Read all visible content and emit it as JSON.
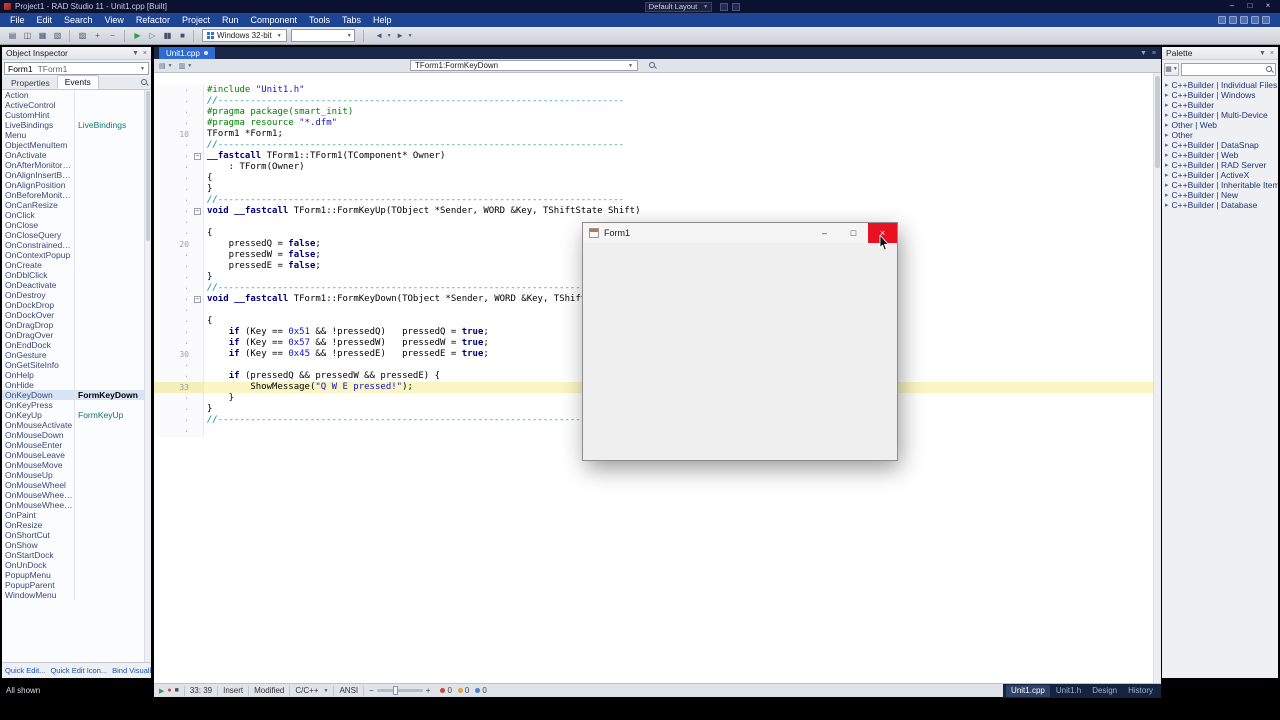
{
  "window": {
    "title": "Project1 - RAD Studio 11 - Unit1.cpp [Built]",
    "layout_combo": "Default Layout"
  },
  "menu": {
    "items": [
      "File",
      "Edit",
      "Search",
      "View",
      "Refactor",
      "Project",
      "Run",
      "Component",
      "Tools",
      "Tabs",
      "Help"
    ]
  },
  "toolbar": {
    "groups": [
      {
        "icons": [
          "new-file",
          "open-file",
          "save",
          "save-all"
        ]
      },
      {
        "icons": [
          "open-project",
          "add-to-project",
          "remove-from-project"
        ]
      },
      {
        "icons": [
          "run",
          "run-without-debugging",
          "pause",
          "stop"
        ]
      }
    ],
    "target_platform": "Windows 32-bit"
  },
  "object_inspector": {
    "title": "Object Inspector",
    "combo": {
      "instance": "Form1",
      "type": "TForm1"
    },
    "tabs": [
      "Properties",
      "Events"
    ],
    "rows": [
      {
        "name": "Action",
        "value": ""
      },
      {
        "name": "ActiveControl",
        "value": ""
      },
      {
        "name": "CustomHint",
        "value": ""
      },
      {
        "name": "LiveBindings",
        "value": "LiveBindings"
      },
      {
        "name": "Menu",
        "value": ""
      },
      {
        "name": "ObjectMenuItem",
        "value": ""
      },
      {
        "name": "OnActivate",
        "value": ""
      },
      {
        "name": "OnAfterMonitorDpiChanged",
        "value": ""
      },
      {
        "name": "OnAlignInsertBefore",
        "value": ""
      },
      {
        "name": "OnAlignPosition",
        "value": ""
      },
      {
        "name": "OnBeforeMonitorDpiChanged",
        "value": ""
      },
      {
        "name": "OnCanResize",
        "value": ""
      },
      {
        "name": "OnClick",
        "value": ""
      },
      {
        "name": "OnClose",
        "value": ""
      },
      {
        "name": "OnCloseQuery",
        "value": ""
      },
      {
        "name": "OnConstrainedResize",
        "value": ""
      },
      {
        "name": "OnContextPopup",
        "value": ""
      },
      {
        "name": "OnCreate",
        "value": ""
      },
      {
        "name": "OnDblClick",
        "value": ""
      },
      {
        "name": "OnDeactivate",
        "value": ""
      },
      {
        "name": "OnDestroy",
        "value": ""
      },
      {
        "name": "OnDockDrop",
        "value": ""
      },
      {
        "name": "OnDockOver",
        "value": ""
      },
      {
        "name": "OnDragDrop",
        "value": ""
      },
      {
        "name": "OnDragOver",
        "value": ""
      },
      {
        "name": "OnEndDock",
        "value": ""
      },
      {
        "name": "OnGesture",
        "value": ""
      },
      {
        "name": "OnGetSiteInfo",
        "value": ""
      },
      {
        "name": "OnHelp",
        "value": ""
      },
      {
        "name": "OnHide",
        "value": ""
      },
      {
        "name": "OnKeyDown",
        "value": "FormKeyDown",
        "selected": true
      },
      {
        "name": "OnKeyPress",
        "value": ""
      },
      {
        "name": "OnKeyUp",
        "value": "FormKeyUp"
      },
      {
        "name": "OnMouseActivate",
        "value": ""
      },
      {
        "name": "OnMouseDown",
        "value": ""
      },
      {
        "name": "OnMouseEnter",
        "value": ""
      },
      {
        "name": "OnMouseLeave",
        "value": ""
      },
      {
        "name": "OnMouseMove",
        "value": ""
      },
      {
        "name": "OnMouseUp",
        "value": ""
      },
      {
        "name": "OnMouseWheel",
        "value": ""
      },
      {
        "name": "OnMouseWheelDown",
        "value": ""
      },
      {
        "name": "OnMouseWheelUp",
        "value": ""
      },
      {
        "name": "OnPaint",
        "value": ""
      },
      {
        "name": "OnResize",
        "value": ""
      },
      {
        "name": "OnShortCut",
        "value": ""
      },
      {
        "name": "OnShow",
        "value": ""
      },
      {
        "name": "OnStartDock",
        "value": ""
      },
      {
        "name": "OnUnDock",
        "value": ""
      },
      {
        "name": "PopupMenu",
        "value": ""
      },
      {
        "name": "PopupParent",
        "value": ""
      },
      {
        "name": "WindowMenu",
        "value": ""
      }
    ],
    "footer_links": [
      "Quick Edit...",
      "Quick Edit Icon...",
      "Bind Visually..."
    ],
    "status": "All shown"
  },
  "editor": {
    "tab_label": "Unit1.cpp",
    "breadcrumb": "TForm1:FormKeyDown",
    "current_line": 33,
    "lines": [
      {
        "gutter": "·",
        "segs": [
          [
            "p",
            "#include "
          ],
          [
            "s",
            "\"Unit1.h\""
          ]
        ]
      },
      {
        "gutter": "·",
        "segs": [
          [
            "c",
            "//---------------------------------------------------------------------------"
          ]
        ]
      },
      {
        "gutter": "·",
        "segs": [
          [
            "p",
            "#pragma package(smart_init)"
          ]
        ]
      },
      {
        "gutter": "·",
        "segs": [
          [
            "p",
            "#pragma resource "
          ],
          [
            "s",
            "\"*.dfm\""
          ]
        ]
      },
      {
        "gutter": "10",
        "segs": [
          [
            "t",
            "TForm1 *Form1;"
          ]
        ]
      },
      {
        "gutter": "·",
        "segs": [
          [
            "c",
            "//---------------------------------------------------------------------------"
          ]
        ]
      },
      {
        "gutter": "·",
        "fold": true,
        "segs": [
          [
            "k",
            "__fastcall"
          ],
          [
            "t",
            " TForm1::TForm1(TComponent* Owner)"
          ]
        ]
      },
      {
        "gutter": "·",
        "segs": [
          [
            "t",
            "    : TForm(Owner)"
          ]
        ]
      },
      {
        "gutter": "·",
        "segs": [
          [
            "t",
            "{"
          ]
        ]
      },
      {
        "gutter": "·",
        "segs": [
          [
            "t",
            "}"
          ]
        ]
      },
      {
        "gutter": "·",
        "segs": [
          [
            "c",
            "//---------------------------------------------------------------------------"
          ]
        ]
      },
      {
        "gutter": "·",
        "fold": true,
        "segs": [
          [
            "k",
            "void"
          ],
          [
            "t",
            " "
          ],
          [
            "k",
            "__fastcall"
          ],
          [
            "t",
            " TForm1::FormKeyUp(TObject *Sender, WORD &Key, TShiftState Shift)"
          ]
        ]
      },
      {
        "gutter": "·",
        "segs": []
      },
      {
        "gutter": "·",
        "segs": [
          [
            "t",
            "{"
          ]
        ]
      },
      {
        "gutter": "20",
        "segs": [
          [
            "t",
            "    pressedQ = "
          ],
          [
            "k",
            "false"
          ],
          [
            "t",
            ";"
          ]
        ]
      },
      {
        "gutter": "·",
        "segs": [
          [
            "t",
            "    pressedW = "
          ],
          [
            "k",
            "false"
          ],
          [
            "t",
            ";"
          ]
        ]
      },
      {
        "gutter": "·",
        "segs": [
          [
            "t",
            "    pressedE = "
          ],
          [
            "k",
            "false"
          ],
          [
            "t",
            ";"
          ]
        ]
      },
      {
        "gutter": "·",
        "segs": [
          [
            "t",
            "}"
          ]
        ]
      },
      {
        "gutter": "·",
        "segs": [
          [
            "c",
            "//---------------------------------------------------------------------------"
          ]
        ]
      },
      {
        "gutter": "·",
        "fold": true,
        "segs": [
          [
            "k",
            "void"
          ],
          [
            "t",
            " "
          ],
          [
            "k",
            "__fastcall"
          ],
          [
            "t",
            " TForm1::FormKeyDown(TObject *Sender, WORD &Key, TShiftState Shift)"
          ]
        ]
      },
      {
        "gutter": "·",
        "segs": []
      },
      {
        "gutter": "·",
        "segs": [
          [
            "t",
            "{"
          ]
        ]
      },
      {
        "gutter": "·",
        "segs": [
          [
            "t",
            "    "
          ],
          [
            "k",
            "if"
          ],
          [
            "t",
            " (Key == "
          ],
          [
            "n",
            "0x51"
          ],
          [
            "t",
            " && !pressedQ)   pressedQ = "
          ],
          [
            "k",
            "true"
          ],
          [
            "t",
            ";"
          ]
        ]
      },
      {
        "gutter": "·",
        "segs": [
          [
            "t",
            "    "
          ],
          [
            "k",
            "if"
          ],
          [
            "t",
            " (Key == "
          ],
          [
            "n",
            "0x57"
          ],
          [
            "t",
            " && !pressedW)   pressedW = "
          ],
          [
            "k",
            "true"
          ],
          [
            "t",
            ";"
          ]
        ]
      },
      {
        "gutter": "30",
        "segs": [
          [
            "t",
            "    "
          ],
          [
            "k",
            "if"
          ],
          [
            "t",
            " (Key == "
          ],
          [
            "n",
            "0x45"
          ],
          [
            "t",
            " && !pressedE)   pressedE = "
          ],
          [
            "k",
            "true"
          ],
          [
            "t",
            ";"
          ]
        ]
      },
      {
        "gutter": "·",
        "segs": []
      },
      {
        "gutter": "·",
        "segs": [
          [
            "t",
            "    "
          ],
          [
            "k",
            "if"
          ],
          [
            "t",
            " (pressedQ && pressedW && pressedE) {"
          ]
        ]
      },
      {
        "gutter": "33",
        "cur": true,
        "segs": [
          [
            "t",
            "        ShowMessage("
          ],
          [
            "s",
            "\"Q W E pressed!\""
          ],
          [
            "t",
            ");"
          ]
        ]
      },
      {
        "gutter": "·",
        "segs": [
          [
            "t",
            "    }"
          ]
        ]
      },
      {
        "gutter": "·",
        "segs": [
          [
            "t",
            "}"
          ]
        ]
      },
      {
        "gutter": "·",
        "segs": [
          [
            "c",
            "//---------------------------------------------------------------------------"
          ]
        ]
      },
      {
        "gutter": "·",
        "segs": []
      }
    ],
    "status": {
      "caret": "33: 39",
      "mode": "Insert",
      "modified": "Modified",
      "syntax": "C/C++",
      "encoding": "ANSI",
      "counts": [
        {
          "name": "errors",
          "value": "0",
          "color": "#c8463c"
        },
        {
          "name": "warnings",
          "value": "0",
          "color": "#e0a23c"
        },
        {
          "name": "hints",
          "value": "0",
          "color": "#4c7fd1"
        }
      ]
    },
    "view_tabs": [
      {
        "label": "Unit1.cpp",
        "active": true
      },
      {
        "label": "Unit1.h"
      },
      {
        "label": "Design"
      },
      {
        "label": "History"
      }
    ]
  },
  "palette": {
    "title": "Palette",
    "items": [
      "C++Builder | Individual Files",
      "C++Builder | Windows",
      "C++Builder",
      "C++Builder | Multi-Device",
      "Other | Web",
      "Other",
      "C++Builder | DataSnap",
      "C++Builder | Web",
      "C++Builder | RAD Server",
      "C++Builder | ActiveX",
      "C++Builder | Inheritable Items",
      "C++Builder | New",
      "C++Builder | Database"
    ]
  },
  "form_window": {
    "title": "Form1"
  }
}
